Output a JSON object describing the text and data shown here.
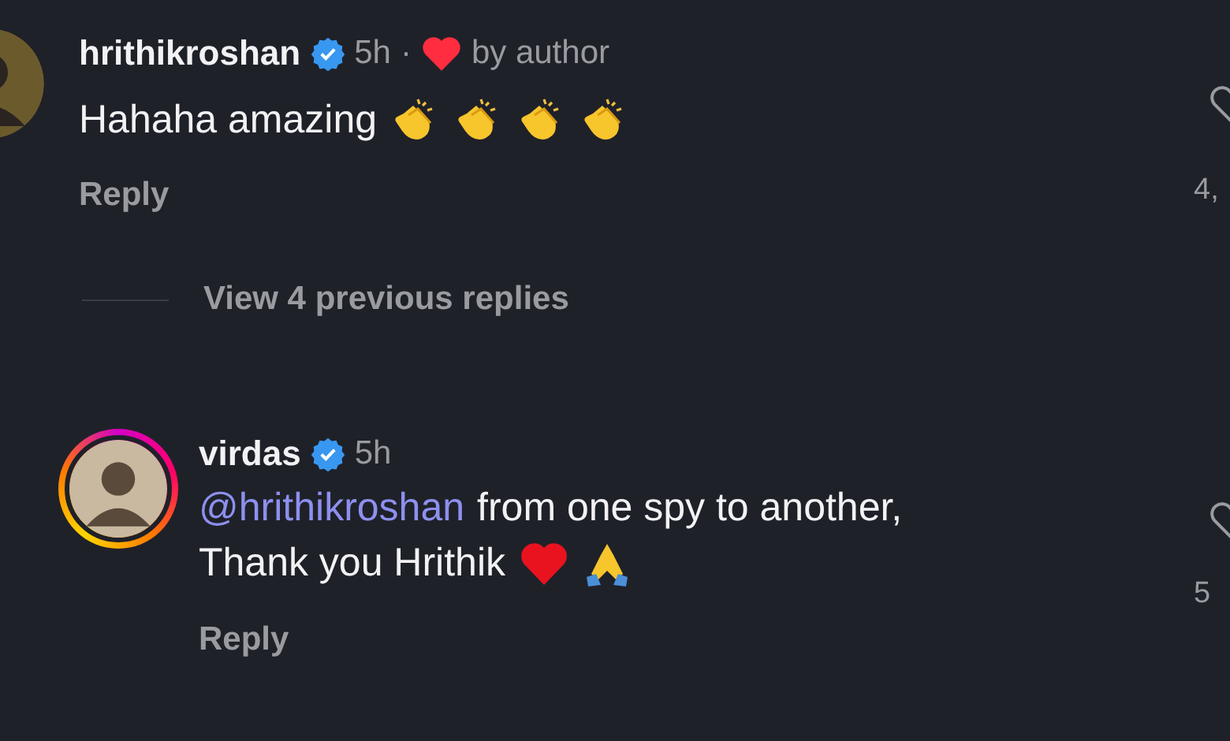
{
  "items": [
    {
      "kind": "comment",
      "username": "hrithikroshan",
      "verified": true,
      "time": "5h",
      "separator": "·",
      "liked_by_author": true,
      "author_label": "by author",
      "story_ring": false,
      "lines": [
        [
          {
            "kind": "text",
            "text": "Hahaha amazing"
          },
          {
            "kind": "clap"
          },
          {
            "kind": "clap"
          },
          {
            "kind": "clap"
          },
          {
            "kind": "clap"
          }
        ]
      ],
      "reply": "Reply",
      "like_count": "4,"
    },
    {
      "kind": "view-replies",
      "text": "View 4 previous replies"
    },
    {
      "kind": "comment",
      "username": "virdas",
      "verified": true,
      "time": "5h",
      "liked_by_author": false,
      "story_ring": true,
      "lines": [
        [
          {
            "kind": "mention",
            "text": "@hrithikroshan"
          },
          {
            "kind": "text",
            "text": "from one spy to another,"
          }
        ],
        [
          {
            "kind": "text",
            "text": "Thank you Hrithik"
          },
          {
            "kind": "heart"
          },
          {
            "kind": "pray"
          }
        ]
      ],
      "reply": "Reply",
      "like_count": "5"
    }
  ]
}
